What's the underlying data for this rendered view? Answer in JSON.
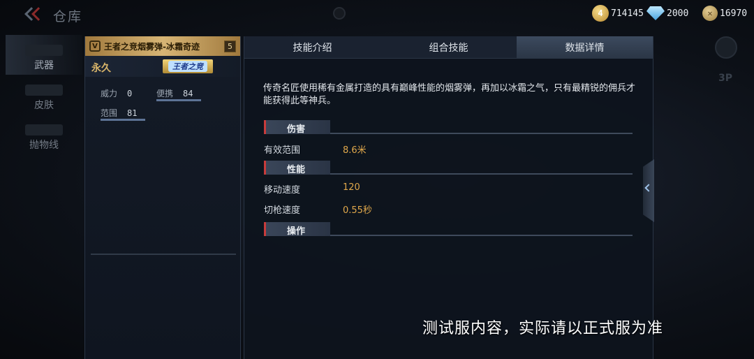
{
  "header": {
    "title": "仓库",
    "currencies": [
      {
        "icon": "gold-rank-icon",
        "icon_text": "4",
        "value": "714145"
      },
      {
        "icon": "diamond-icon",
        "value": "2000"
      },
      {
        "icon": "coin-icon",
        "value": "16970"
      }
    ]
  },
  "sidebar": {
    "items": [
      {
        "label": "武器",
        "active": true
      },
      {
        "label": "皮肤",
        "active": false
      },
      {
        "label": "抛物线",
        "active": false
      }
    ]
  },
  "weapon_card": {
    "badge": "V",
    "name": "王者之竞烟雾弹-冰霜奇迹",
    "level": "5",
    "duration": "永久",
    "rank_badge": "王者之竞",
    "stats": [
      {
        "label": "威力",
        "value": "0"
      },
      {
        "label": "便携",
        "value": "84"
      },
      {
        "label": "范围",
        "value": "81"
      }
    ]
  },
  "tabs": [
    {
      "label": "技能介绍",
      "active": false
    },
    {
      "label": "组合技能",
      "active": false
    },
    {
      "label": "数据详情",
      "active": true
    }
  ],
  "details": {
    "description": "传奇名匠使用稀有金属打造的具有巅峰性能的烟雾弹，再加以冰霜之气，只有最精锐的佣兵才能获得此等神兵。",
    "sections": [
      {
        "title": "伤害",
        "rows": [
          {
            "label": "有效范围",
            "value": "8.6米"
          }
        ]
      },
      {
        "title": "性能",
        "rows": [
          {
            "label": "移动速度",
            "value": "120"
          },
          {
            "label": "切枪速度",
            "value": "0.55秒"
          }
        ]
      },
      {
        "title": "操作",
        "rows": []
      }
    ]
  },
  "view_mode": "3P",
  "subtitle": "测试服内容，实际请以正式服为准",
  "colors": {
    "accent_gold": "#d7b575",
    "value_orange": "#e0a84b",
    "active_tab": "#3c4a5e"
  }
}
